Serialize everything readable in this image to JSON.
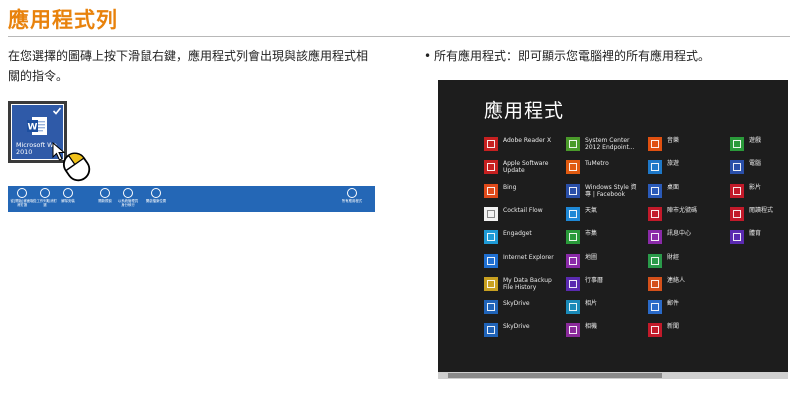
{
  "header": {
    "title": "應用程式列"
  },
  "left": {
    "description": "在您選擇的圖磚上按下滑鼠右鍵，應用程式列會出現與該應用程式相關的指令。",
    "tile": {
      "label": "Microsoft Wo\n2010",
      "icon": "word-icon",
      "color": "#2f5aa8"
    },
    "appbar": {
      "color": "#2467b6",
      "buttons": [
        {
          "label": "從[開始]畫面取\n消釘選",
          "icon": "unpin-icon"
        },
        {
          "label": "從工作列取消釘\n選",
          "icon": "taskbar-unpin-icon"
        },
        {
          "label": "解除安裝",
          "icon": "uninstall-icon"
        },
        {
          "label": "開新視窗",
          "icon": "new-window-icon"
        },
        {
          "label": "以系統管理員\n身分執行",
          "icon": "admin-icon"
        },
        {
          "label": "開啟檔案位置",
          "icon": "folder-icon"
        },
        {
          "label": "所有應用程式",
          "icon": "all-apps-icon"
        }
      ]
    }
  },
  "right": {
    "description": "所有應用程式：即可顯示您電腦裡的所有應用程式。",
    "screen": {
      "title": "應用程式",
      "columns": [
        [
          {
            "label": "Adobe Reader X",
            "icon": "adobe-reader-icon",
            "color": "#c62020"
          },
          {
            "label": "Apple Software\nUpdate",
            "icon": "apple-update-icon",
            "color": "#c62020"
          },
          {
            "label": "Bing",
            "icon": "bing-icon",
            "color": "#e04a1a"
          },
          {
            "label": "Cocktail Flow",
            "icon": "cocktail-icon",
            "color": "#f2f2f2"
          },
          {
            "label": "Engadget",
            "icon": "engadget-icon",
            "color": "#1e9ad6"
          },
          {
            "label": "Internet Explorer",
            "icon": "ie-icon",
            "color": "#1f6fd1"
          },
          {
            "label": "My Data Backup\nFile History",
            "icon": "backup-icon",
            "color": "#c8a020"
          },
          {
            "label": "SkyDrive",
            "icon": "skydrive-icon",
            "color": "#1f63b8"
          },
          {
            "label": "SkyDrive",
            "icon": "skydrive-icon",
            "color": "#1f63b8"
          }
        ],
        [
          {
            "label": "System Center\n2012 Endpoint...",
            "icon": "system-center-icon",
            "color": "#4a9a2a"
          },
          {
            "label": "TuMetro",
            "icon": "tumetro-icon",
            "color": "#e05a10"
          },
          {
            "label": "Windows Style 資\n專 | Facebook",
            "icon": "facebook-icon",
            "color": "#2a4fa8"
          },
          {
            "label": "天氣",
            "icon": "weather-icon",
            "color": "#1e88d6"
          },
          {
            "label": "市集",
            "icon": "store-icon",
            "color": "#2a9a3a"
          },
          {
            "label": "地圖",
            "icon": "maps-icon",
            "color": "#8a2aa8"
          },
          {
            "label": "行事曆",
            "icon": "calendar-icon",
            "color": "#5a2ab0"
          },
          {
            "label": "相片",
            "icon": "photos-icon",
            "color": "#1a8ab8"
          },
          {
            "label": "相機",
            "icon": "camera-icon",
            "color": "#8a2a9a"
          }
        ],
        [
          {
            "label": "音樂",
            "icon": "music-icon",
            "color": "#e05010"
          },
          {
            "label": "旅遊",
            "icon": "travel-icon",
            "color": "#1e78c8"
          },
          {
            "label": "桌面",
            "icon": "desktop-icon",
            "color": "#2a5ab8"
          },
          {
            "label": "陣市尤號碼",
            "icon": "video-icon",
            "color": "#c21a2a"
          },
          {
            "label": "訊息中心",
            "icon": "messaging-icon",
            "color": "#8a2aa8"
          },
          {
            "label": "財經",
            "icon": "finance-icon",
            "color": "#2a9a4a"
          },
          {
            "label": "連絡人",
            "icon": "people-icon",
            "color": "#d4501a"
          },
          {
            "label": "郵件",
            "icon": "mail-icon",
            "color": "#2a6ac8"
          },
          {
            "label": "新聞",
            "icon": "news-icon",
            "color": "#c21a2a"
          }
        ],
        [
          {
            "label": "遊戲",
            "icon": "games-icon",
            "color": "#2a9a3a"
          },
          {
            "label": "電腦",
            "icon": "computer-icon",
            "color": "#2a4fa8"
          },
          {
            "label": "影片",
            "icon": "movies-icon",
            "color": "#c21a2a"
          },
          {
            "label": "閱讀程式",
            "icon": "reader-icon",
            "color": "#c21a2a"
          },
          {
            "label": "體育",
            "icon": "sports-icon",
            "color": "#5a2ab0"
          }
        ]
      ]
    }
  },
  "colors": {
    "accent": "#e8820c",
    "screen_bg": "#1d1d1d"
  }
}
